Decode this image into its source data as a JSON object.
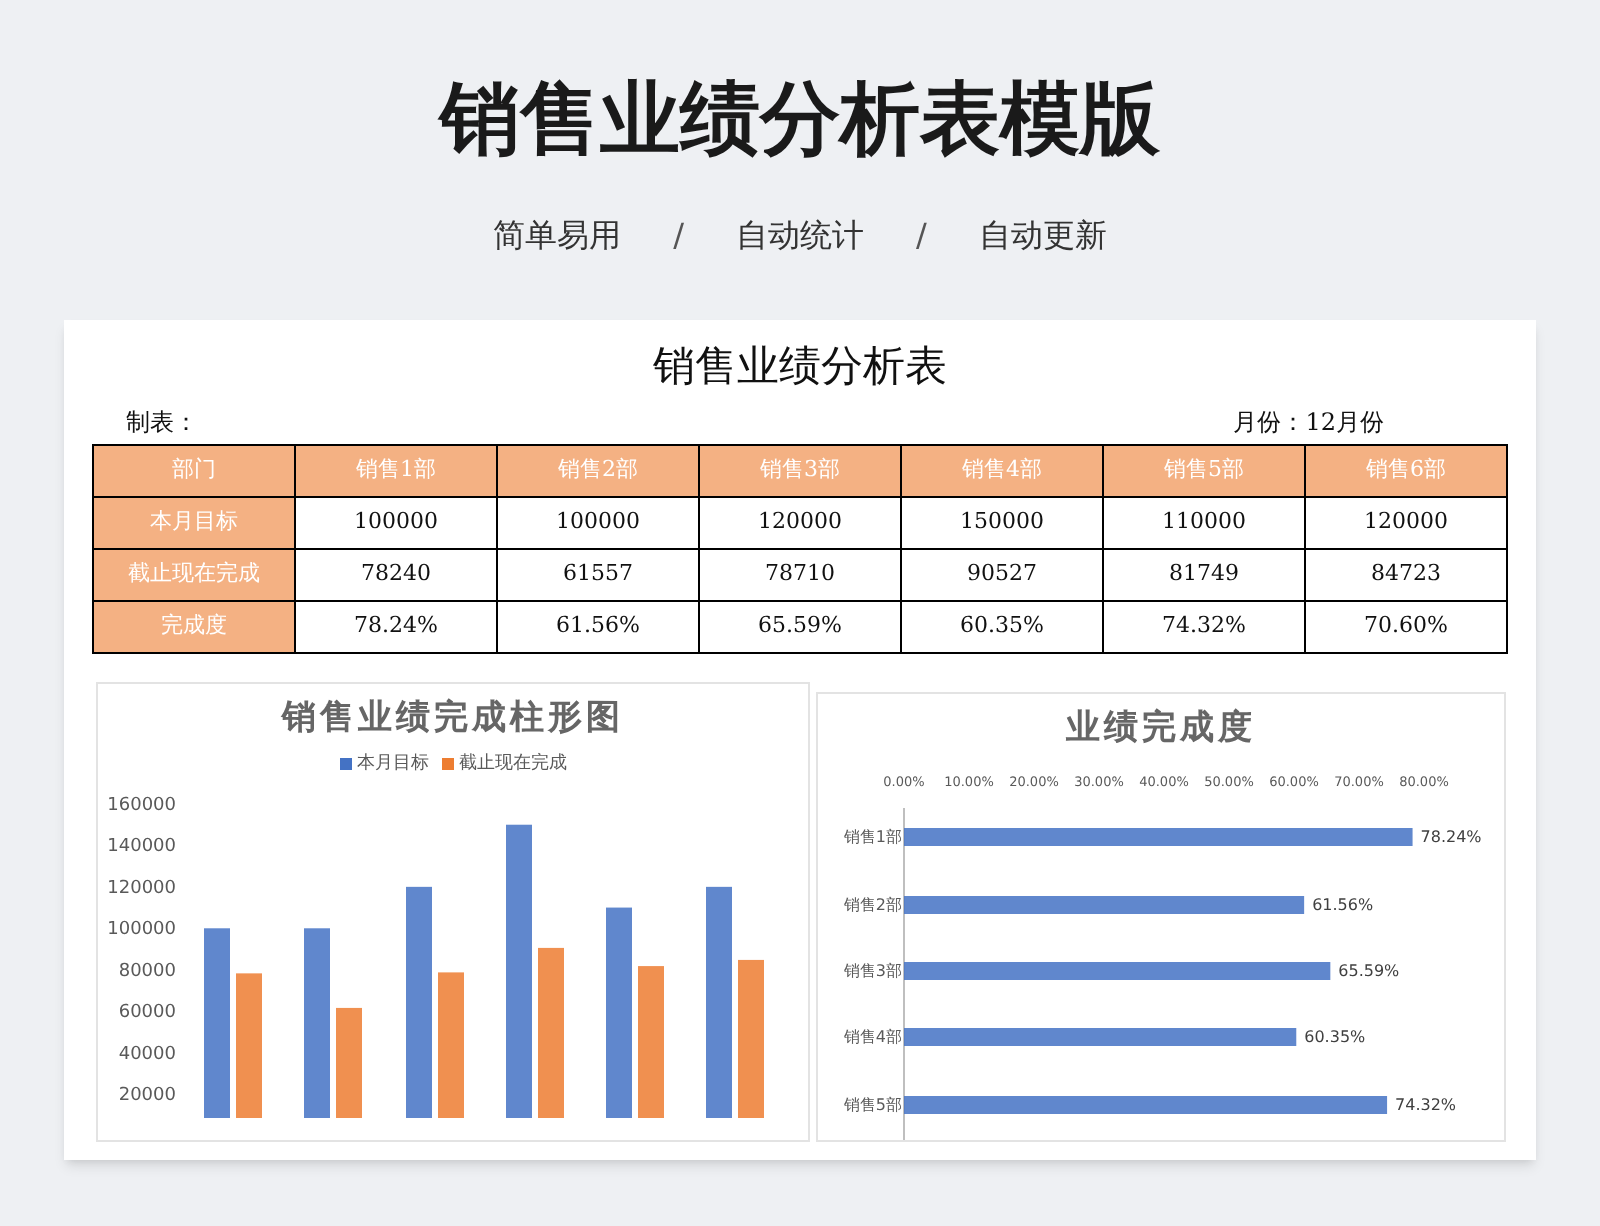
{
  "page": {
    "title": "销售业绩分析表模版",
    "features": [
      "简单易用",
      "自动统计",
      "自动更新"
    ],
    "separator": "/"
  },
  "sheet": {
    "title": "销售业绩分析表",
    "maker_label": "制表：",
    "month_label": "月份：12月份",
    "table": {
      "columns": [
        "部门",
        "销售1部",
        "销售2部",
        "销售3部",
        "销售4部",
        "销售5部",
        "销售6部"
      ],
      "rows": [
        [
          "本月目标",
          "100000",
          "100000",
          "120000",
          "150000",
          "110000",
          "120000"
        ],
        [
          "截止现在完成",
          "78240",
          "61557",
          "78710",
          "90527",
          "81749",
          "84723"
        ],
        [
          "完成度",
          "78.24%",
          "61.56%",
          "65.59%",
          "60.35%",
          "74.32%",
          "70.60%"
        ]
      ]
    }
  },
  "bar_chart": {
    "chart_data": {
      "type": "bar",
      "title": "销售业绩完成柱形图",
      "orientation": "vertical",
      "ylim": [
        8414,
        160000
      ],
      "yticks": [
        20000,
        40000,
        60000,
        80000,
        100000,
        120000,
        140000,
        160000
      ],
      "series": [
        {
          "name": "本月目标",
          "color": "#4472c4",
          "values": [
            100000,
            100000,
            120000,
            150000,
            110000,
            120000
          ]
        },
        {
          "name": "截止现在完成",
          "color": "#ed7d31",
          "values": [
            78240,
            61557,
            78710,
            90527,
            81749,
            84723
          ]
        }
      ]
    }
  },
  "completion_chart": {
    "chart_data": {
      "type": "bar",
      "title": "业绩完成度",
      "orientation": "horizontal",
      "categories": [
        "销售1部",
        "销售2部",
        "销售3部",
        "销售4部",
        "销售5部"
      ],
      "xlim": [
        0,
        0.8
      ],
      "xticks": [
        {
          "value": 0,
          "label": "0.00%"
        },
        {
          "value": 0.1,
          "label": "10.00%"
        },
        {
          "value": 0.2,
          "label": "20.00%"
        },
        {
          "value": 0.3,
          "label": "30.00%"
        },
        {
          "value": 0.4,
          "label": "40.00%"
        },
        {
          "value": 0.5,
          "label": "50.00%"
        },
        {
          "value": 0.6,
          "label": "60.00%"
        },
        {
          "value": 0.7,
          "label": "70.00%"
        },
        {
          "value": 0.8,
          "label": "80.00%"
        }
      ],
      "series": [
        {
          "color": "#4472c4",
          "values": [
            0.7824,
            0.6156,
            0.6559,
            0.6035,
            0.7432
          ]
        }
      ],
      "value_labels": [
        "78.24%",
        "61.56%",
        "65.59%",
        "60.35%",
        "74.32%"
      ]
    }
  }
}
